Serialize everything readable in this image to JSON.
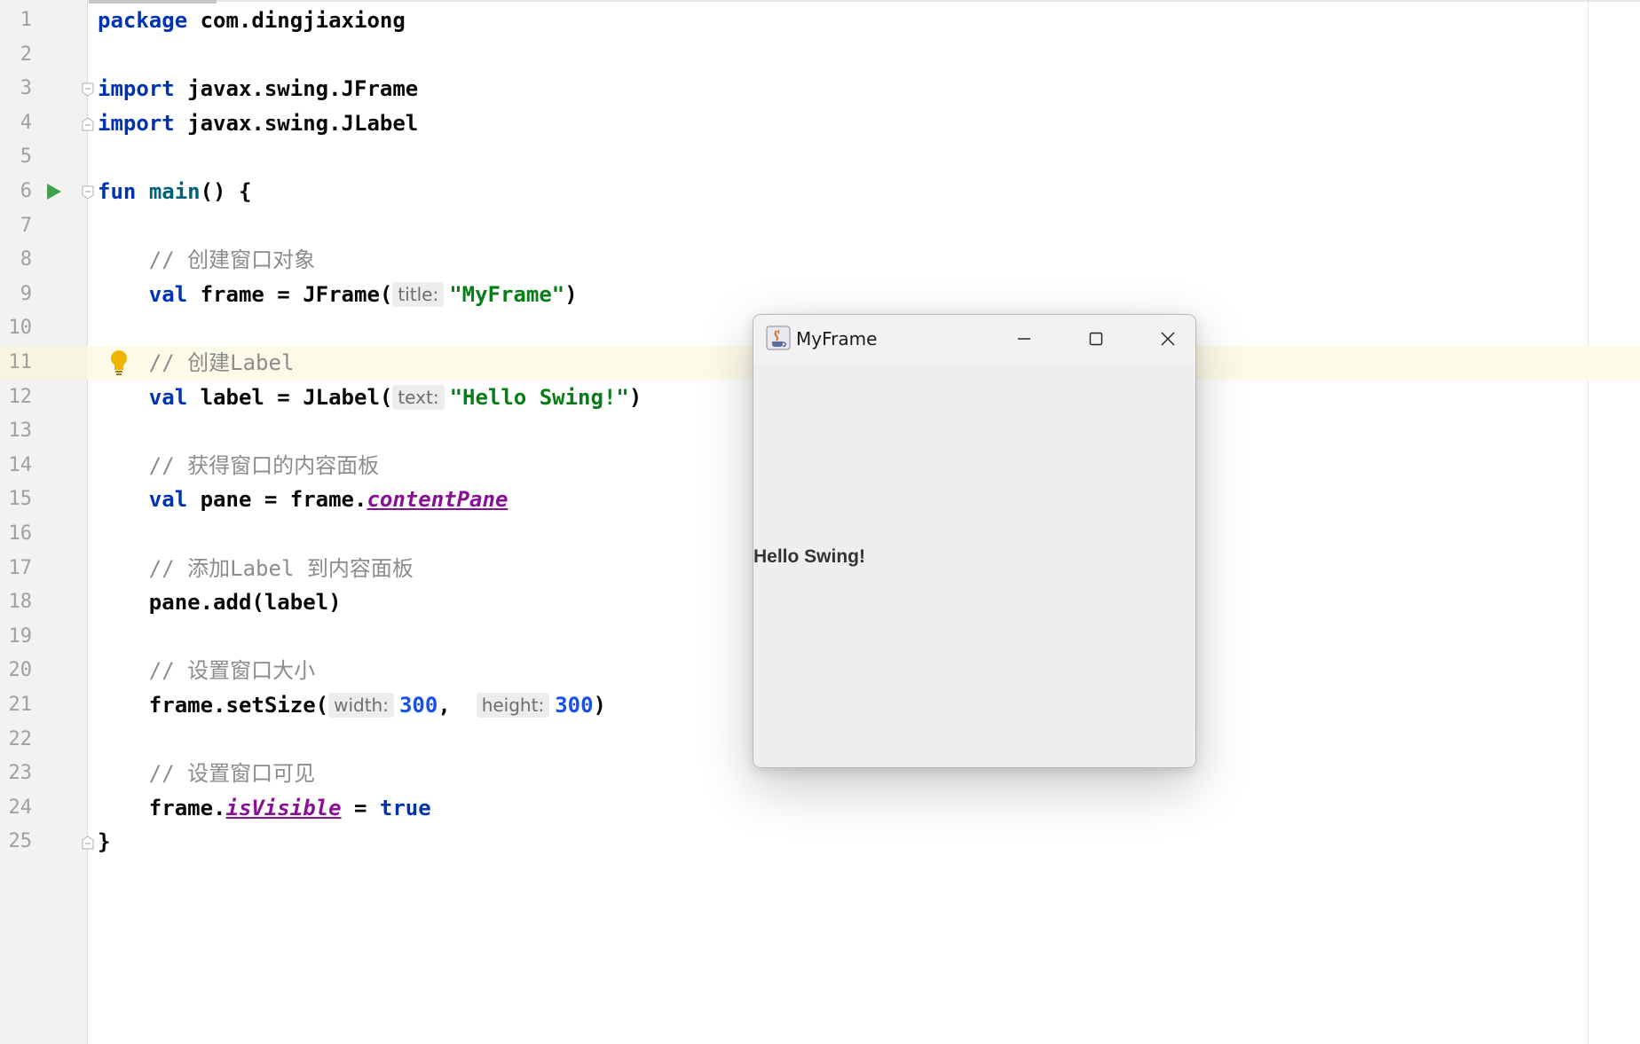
{
  "editor": {
    "lines": [
      {
        "n": "1",
        "segments": [
          {
            "t": "package",
            "c": "kw"
          },
          {
            "t": " com.dingjiaxiong",
            "c": ""
          }
        ]
      },
      {
        "n": "2",
        "segments": []
      },
      {
        "n": "3",
        "segments": [
          {
            "t": "import",
            "c": "kw"
          },
          {
            "t": " javax.swing.JFrame",
            "c": ""
          }
        ]
      },
      {
        "n": "4",
        "segments": [
          {
            "t": "import",
            "c": "kw"
          },
          {
            "t": " javax.swing.JLabel",
            "c": ""
          }
        ]
      },
      {
        "n": "5",
        "segments": []
      },
      {
        "n": "6",
        "segments": [
          {
            "t": "fun",
            "c": "kw"
          },
          {
            "t": " ",
            "c": ""
          },
          {
            "t": "main",
            "c": "fn"
          },
          {
            "t": "() {",
            "c": ""
          }
        ]
      },
      {
        "n": "7",
        "segments": []
      },
      {
        "n": "8",
        "segments": [
          {
            "t": "    ",
            "c": ""
          },
          {
            "t": "// ",
            "c": "cm"
          },
          {
            "t": "创建窗口对象",
            "c": "cm"
          }
        ]
      },
      {
        "n": "9",
        "segments": [
          {
            "t": "    ",
            "c": ""
          },
          {
            "t": "val",
            "c": "kw"
          },
          {
            "t": " frame = JFrame(",
            "c": ""
          },
          {
            "t": "title:",
            "c": "hint"
          },
          {
            "t": "\"MyFrame\"",
            "c": "str"
          },
          {
            "t": ")",
            "c": ""
          }
        ]
      },
      {
        "n": "10",
        "segments": []
      },
      {
        "n": "11",
        "segments": [
          {
            "t": "    ",
            "c": ""
          },
          {
            "t": "// ",
            "c": "cm"
          },
          {
            "t": "创建",
            "c": "cm"
          },
          {
            "t": "Label",
            "c": "cmk"
          }
        ]
      },
      {
        "n": "12",
        "segments": [
          {
            "t": "    ",
            "c": ""
          },
          {
            "t": "val",
            "c": "kw"
          },
          {
            "t": " label = JLabel(",
            "c": ""
          },
          {
            "t": "text:",
            "c": "hint"
          },
          {
            "t": "\"Hello Swing!\"",
            "c": "str"
          },
          {
            "t": ")",
            "c": ""
          }
        ]
      },
      {
        "n": "13",
        "segments": []
      },
      {
        "n": "14",
        "segments": [
          {
            "t": "    ",
            "c": ""
          },
          {
            "t": "// ",
            "c": "cm"
          },
          {
            "t": "获得窗口的内容面板",
            "c": "cm"
          }
        ]
      },
      {
        "n": "15",
        "segments": [
          {
            "t": "    ",
            "c": ""
          },
          {
            "t": "val",
            "c": "kw"
          },
          {
            "t": " pane = frame.",
            "c": ""
          },
          {
            "t": "contentPane",
            "c": "prop"
          }
        ]
      },
      {
        "n": "16",
        "segments": []
      },
      {
        "n": "17",
        "segments": [
          {
            "t": "    ",
            "c": ""
          },
          {
            "t": "// ",
            "c": "cm"
          },
          {
            "t": "添加",
            "c": "cm"
          },
          {
            "t": "Label",
            "c": "cmk"
          },
          {
            "t": " 到内容面板",
            "c": "cm"
          }
        ]
      },
      {
        "n": "18",
        "segments": [
          {
            "t": "    ",
            "c": ""
          },
          {
            "t": "pane.add(label)",
            "c": ""
          }
        ]
      },
      {
        "n": "19",
        "segments": []
      },
      {
        "n": "20",
        "segments": [
          {
            "t": "    ",
            "c": ""
          },
          {
            "t": "// ",
            "c": "cm"
          },
          {
            "t": "设置窗口大小",
            "c": "cm"
          }
        ]
      },
      {
        "n": "21",
        "segments": [
          {
            "t": "    ",
            "c": ""
          },
          {
            "t": "frame.setSize(",
            "c": ""
          },
          {
            "t": "width:",
            "c": "hint"
          },
          {
            "t": "300",
            "c": "num"
          },
          {
            "t": ",  ",
            "c": ""
          },
          {
            "t": "height:",
            "c": "hint"
          },
          {
            "t": "300",
            "c": "num"
          },
          {
            "t": ")",
            "c": ""
          }
        ]
      },
      {
        "n": "22",
        "segments": []
      },
      {
        "n": "23",
        "segments": [
          {
            "t": "    ",
            "c": ""
          },
          {
            "t": "// ",
            "c": "cm"
          },
          {
            "t": "设置窗口可见",
            "c": "cm"
          }
        ]
      },
      {
        "n": "24",
        "segments": [
          {
            "t": "    ",
            "c": ""
          },
          {
            "t": "frame.",
            "c": ""
          },
          {
            "t": "isVisible",
            "c": "prop"
          },
          {
            "t": " = ",
            "c": ""
          },
          {
            "t": "true",
            "c": "kw"
          }
        ]
      },
      {
        "n": "25",
        "segments": [
          {
            "t": "}",
            "c": ""
          }
        ]
      }
    ],
    "highlighted_line": "11",
    "run_icon_line": "6",
    "fold_icon_lines": [
      "3",
      "4",
      "6",
      "25"
    ],
    "bulb_icon_line": "11",
    "colors": {
      "keyword": "#0033b3",
      "function": "#00627a",
      "string": "#067d17",
      "number": "#1750eb",
      "property": "#871094",
      "comment": "#8c8c8c",
      "current_line": "#fdfbe8"
    }
  },
  "swing_window": {
    "title": "MyFrame",
    "app_icon": "java-cup-icon",
    "label_text": "Hello Swing!",
    "controls": [
      "minimize-icon",
      "maximize-icon",
      "close-icon"
    ]
  }
}
